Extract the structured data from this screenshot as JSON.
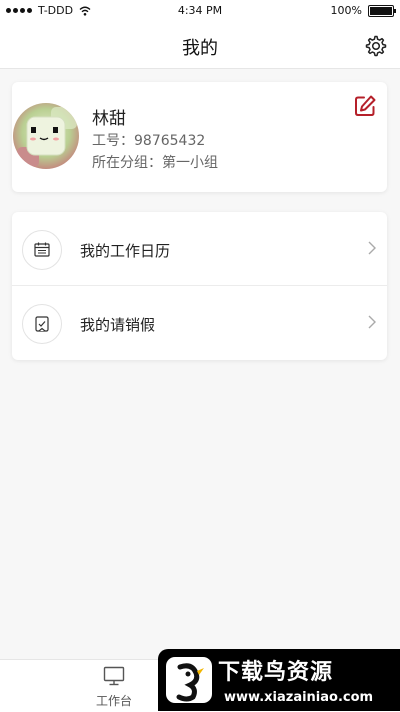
{
  "status_bar": {
    "carrier": "T-DDD",
    "time": "4:34 PM",
    "battery": "100%",
    "battery_level": 1.0
  },
  "nav": {
    "title": "我的"
  },
  "profile": {
    "name": "林甜",
    "employee_id": "工号：98765432",
    "group": "所在分组：第一小组"
  },
  "menu": {
    "items": [
      {
        "label": "我的工作日历",
        "icon": "calendar-icon"
      },
      {
        "label": "我的请销假",
        "icon": "leave-icon"
      }
    ]
  },
  "tab_bar": {
    "items": [
      {
        "label": "工作台",
        "icon": "monitor-icon"
      }
    ]
  },
  "watermark": {
    "title": "下载鸟资源",
    "url": "www.xiazainiao.com"
  },
  "colors": {
    "accent": "#b5202a"
  }
}
